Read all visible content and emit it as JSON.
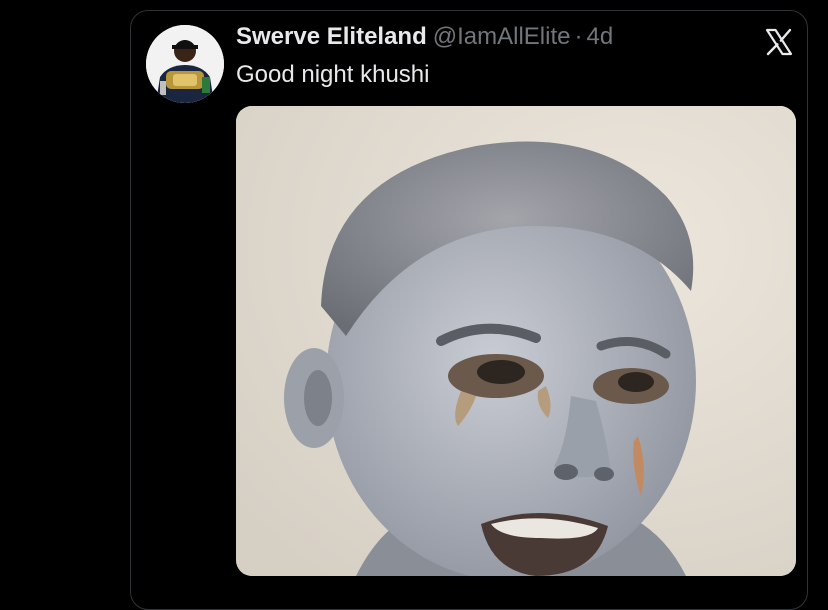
{
  "tweet": {
    "display_name": "Swerve Eliteland",
    "handle": "@IamAllElite",
    "separator": "·",
    "timestamp": "4d",
    "text": "Good night khushi",
    "brand_icon": "x-logo-icon",
    "media_description": "photo-attachment"
  },
  "colors": {
    "background": "#000000",
    "text_primary": "#e7e9ea",
    "text_secondary": "#71767b",
    "border": "#2f3336"
  }
}
